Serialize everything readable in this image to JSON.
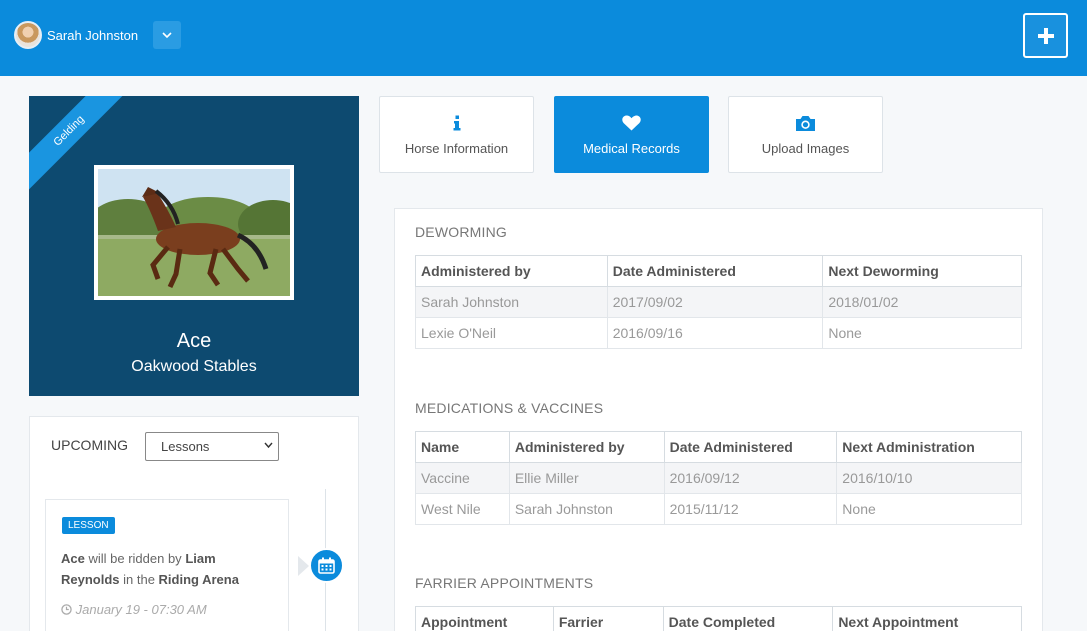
{
  "topbar": {
    "user_name": "Sarah Johnston",
    "add_icon": "plus-icon",
    "toggle_icon": "chevron-down-icon",
    "accent_color": "#0b8bdc"
  },
  "profile": {
    "ribbon": "Gelding",
    "horse_name": "Ace",
    "stable": "Oakwood Stables"
  },
  "upcoming": {
    "title": "UPCOMING",
    "select_value": "Lessons",
    "event": {
      "badge": "LESSON",
      "horse": "Ace",
      "text_1": " will be ridden by ",
      "rider": "Liam Reynolds",
      "text_2": " in the ",
      "location": "Riding Arena",
      "date": "January 19 - 07:30 AM",
      "icon": "calendar-icon"
    }
  },
  "tabs": [
    {
      "label": "Horse Information",
      "icon": "info-icon"
    },
    {
      "label": "Medical Records",
      "icon": "heart-icon"
    },
    {
      "label": "Upload Images",
      "icon": "camera-icon"
    }
  ],
  "deworming": {
    "title": "DEWORMING",
    "headers": [
      "Administered by",
      "Date Administered",
      "Next Deworming"
    ],
    "rows": [
      [
        "Sarah Johnston",
        "2017/09/02",
        "2018/01/02"
      ],
      [
        "Lexie O'Neil",
        "2016/09/16",
        "None"
      ]
    ]
  },
  "medications": {
    "title": "MEDICATIONS & VACCINES",
    "headers": [
      "Name",
      "Administered by",
      "Date Administered",
      "Next Administration"
    ],
    "rows": [
      [
        "Vaccine",
        "Ellie Miller",
        "2016/09/12",
        "2016/10/10"
      ],
      [
        "West Nile",
        "Sarah Johnston",
        "2015/11/12",
        "None"
      ]
    ]
  },
  "farrier": {
    "title": "FARRIER APPOINTMENTS",
    "headers": [
      "Appointment",
      "Farrier",
      "Date Completed",
      "Next Appointment"
    ]
  }
}
